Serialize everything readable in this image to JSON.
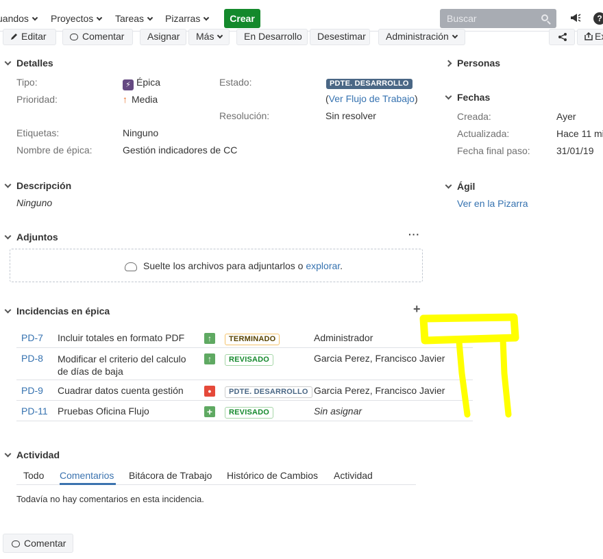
{
  "nav": {
    "items": [
      "uandos",
      "Proyectos",
      "Tareas",
      "Pizarras"
    ],
    "create_label": "Crear",
    "search_placeholder": "Buscar",
    "help_label": "?"
  },
  "toolbar": {
    "edit": "Editar",
    "comment": "Comentar",
    "assign": "Asignar",
    "more": "Más",
    "in_dev": "En Desarrollo",
    "dismiss": "Desestimar",
    "admin": "Administración",
    "export": "Ex"
  },
  "details": {
    "header": "Detalles",
    "type_label": "Tipo:",
    "type_value": "Épica",
    "priority_label": "Prioridad:",
    "priority_value": "Media",
    "status_label": "Estado:",
    "status_value": "PDTE. DESARROLLO",
    "workflow_open": "(",
    "workflow_link": "Ver Flujo de Trabajo",
    "workflow_close": ")",
    "resolution_label": "Resolución:",
    "resolution_value": "Sin resolver",
    "labels_label": "Etiquetas:",
    "labels_value": "Ninguno",
    "epic_name_label": "Nombre de épica:",
    "epic_name_value": "Gestión indicadores de CC"
  },
  "description": {
    "header": "Descripción",
    "value": "Ninguno"
  },
  "attachments": {
    "header": "Adjuntos",
    "more": "···",
    "drop_text": "Suelte los archivos para adjuntarlos o ",
    "browse": "explorar",
    "period": "."
  },
  "epic_issues": {
    "header": "Incidencias en épica",
    "add": "+",
    "rows": [
      {
        "key": "PD-7",
        "summary": "Incluir totales en formato PDF",
        "status": "TERMINADO",
        "assignee": "Administrador"
      },
      {
        "key": "PD-8",
        "summary": "Modificar el criterio del calculo de días de baja",
        "status": "REVISADO",
        "assignee": "Garcia Perez, Francisco Javier"
      },
      {
        "key": "PD-9",
        "summary": "Cuadrar datos cuenta gestión",
        "status": "PDTE. DESARROLLO",
        "assignee": "Garcia Perez, Francisco Javier"
      },
      {
        "key": "PD-11",
        "summary": "Pruebas Oficina Flujo",
        "status": "REVISADO",
        "assignee": "Sin asignar"
      }
    ]
  },
  "activity": {
    "header": "Actividad",
    "tabs": [
      "Todo",
      "Comentarios",
      "Bitácora de Trabajo",
      "Histórico de Cambios",
      "Actividad"
    ],
    "empty": "Todavía no hay comentarios en esta incidencia.",
    "comment_button": "Comentar"
  },
  "people": {
    "header": "Personas"
  },
  "dates": {
    "header": "Fechas",
    "created_label": "Creada:",
    "created_value": "Ayer",
    "updated_label": "Actualizada:",
    "updated_value": "Hace 11 mi",
    "step_label": "Fecha final paso:",
    "step_value": "31/01/19"
  },
  "agile": {
    "header": "Ágil",
    "link": "Ver en la Pizarra"
  },
  "annotation_color": "#ffff00"
}
